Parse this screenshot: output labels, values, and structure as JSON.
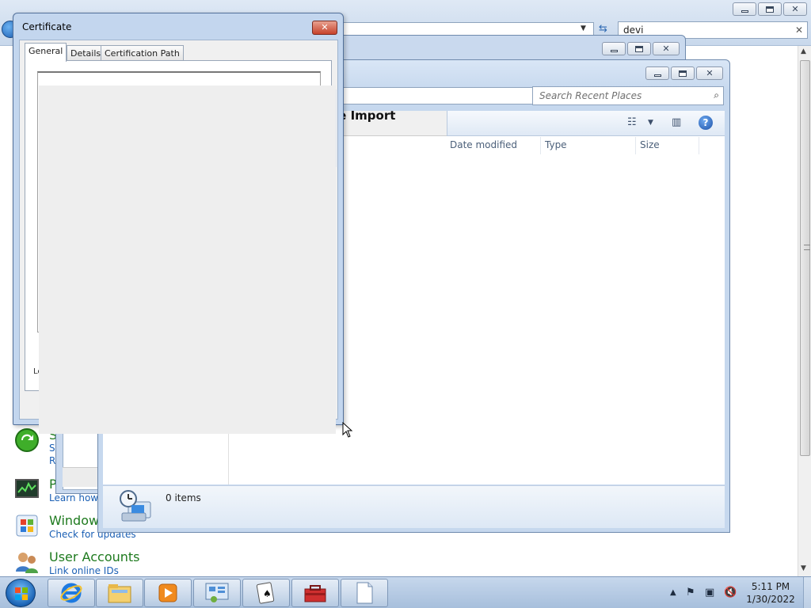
{
  "background_window": {
    "search_value": "devi",
    "control_panel_items": [
      {
        "icon": "backup-icon",
        "title": "S",
        "links": [
          "Sy",
          "R"
        ]
      },
      {
        "icon": "performance-icon",
        "title": "P",
        "links": [
          "Learn how t"
        ]
      },
      {
        "icon": "windows-update-icon",
        "title": "Windows",
        "links": [
          "Check for updates"
        ]
      },
      {
        "icon": "user-accounts-icon",
        "title": "User Accounts",
        "links": [
          "Link online IDs"
        ]
      }
    ]
  },
  "explorer_window": {
    "heading_partial": "te Import",
    "search_placeholder": "Search Recent Places",
    "columns": [
      "Date modified",
      "Type",
      "Size"
    ],
    "status_text": "0 items"
  },
  "certificate_dialog": {
    "title": "Certificate",
    "tabs": [
      "General",
      "Details",
      "Certification Path"
    ],
    "active_tab": "General",
    "partial_label": "Le"
  },
  "taskbar": {
    "buttons": [
      "internet-explorer-icon",
      "windows-explorer-icon",
      "media-player-icon",
      "control-panel-icon",
      "solitaire-icon",
      "toolbox-icon",
      "document-icon"
    ],
    "clock_time": "5:11 PM",
    "clock_date": "1/30/2022"
  },
  "colors": {
    "accent_blue": "#1a5fb4",
    "cp_title_green": "#1e7a1e",
    "close_red": "#c7422b"
  }
}
